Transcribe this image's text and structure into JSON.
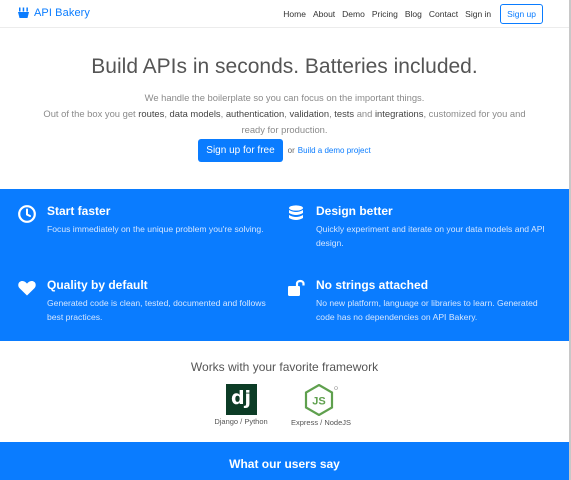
{
  "brand": {
    "name": "API Bakery"
  },
  "nav": {
    "items": [
      "Home",
      "About",
      "Demo",
      "Pricing",
      "Blog",
      "Contact",
      "Sign in"
    ],
    "signup": "Sign up"
  },
  "hero": {
    "title": "Build APIs in seconds. Batteries included.",
    "line1": "We handle the boilerplate so you can focus on the important things.",
    "line2_prefix": "Out of the box you get ",
    "routes": "routes",
    "sep1": ", ",
    "data_models": "data models",
    "sep2": ", ",
    "authentication": "authentication",
    "sep3": ", ",
    "validation": "validation",
    "sep4": ", ",
    "tests": "tests",
    "sep5": " and ",
    "integrations": "integrations",
    "line2_suffix": ", customized for you and",
    "line3": "ready for production.",
    "cta": "Sign up for free",
    "or": "or",
    "demo_link": "Build a demo project"
  },
  "features": [
    {
      "icon": "clock-icon",
      "title": "Start faster",
      "text": "Focus immediately on the unique problem you're solving."
    },
    {
      "icon": "database-icon",
      "title": "Design better",
      "text": "Quickly experiment and iterate on your data models and API design."
    },
    {
      "icon": "heart-icon",
      "title": "Quality by default",
      "text": "Generated code is clean, tested, documented and follows best practices."
    },
    {
      "icon": "unlock-icon",
      "title": "No strings attached",
      "text": "No new platform, language or libraries to learn. Generated code has no dependencies on API Bakery."
    }
  ],
  "frameworks": {
    "title": "Works with your favorite framework",
    "items": [
      {
        "logo": "dj",
        "label": "Django / Python"
      },
      {
        "logo": "JS",
        "label": "Express / NodeJS"
      }
    ]
  },
  "users": {
    "title": "What our users say"
  },
  "colors": {
    "accent": "#0a7cff",
    "django": "#0c3c26",
    "node": "#5fa04e"
  }
}
